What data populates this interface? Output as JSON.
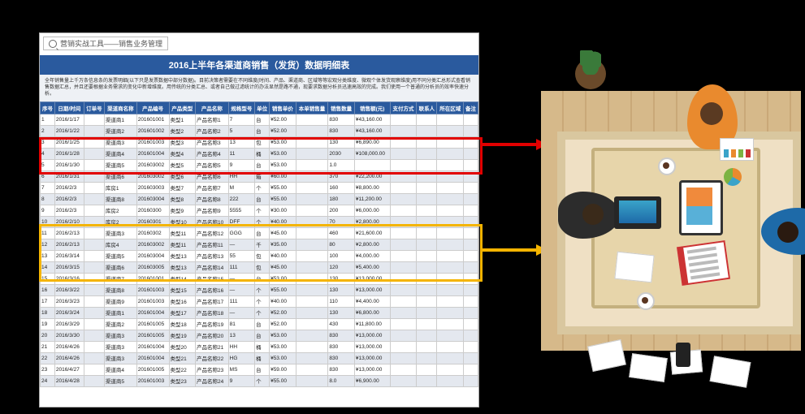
{
  "search": {
    "label": "营销实战工具——销售业务管理"
  },
  "title": "2016上半年各渠道商销售（发货）数据明细表",
  "description": "全年销售量上千万条信息条的发票明细(以下只是发票数据中部分数据)。目前决策者需要在不同维度(时间、产品、渠道商、区域等等宏观分类维度、微观个体发货观察维度)用不同分类汇总形式查看销售数据汇总，并且还要根据业务需求的变化中新增维度。用传统的分类汇总、或者自己做过滤统计的办法显然是路不通，现要求数据分析员迅速高效的完成。我们使用一个普通的分析员的效率快速分析。",
  "columns": [
    "序号",
    "日期/时间",
    "订单号",
    "渠道商名称",
    "产品编号",
    "产品类型",
    "产品名称",
    "规格型号",
    "单位",
    "销售单价",
    "本单销售量",
    "销售数量",
    "销售额(元)",
    "支付方式",
    "联系人",
    "所在区域",
    "备注"
  ],
  "rows": [
    {
      "c": [
        "1",
        "2016/1/17",
        "",
        "渠道商1",
        "201601001",
        "类型1",
        "产品名称1",
        "7",
        "台",
        "¥52.00",
        "",
        "830",
        "¥43,160.00",
        "",
        "",
        "",
        ""
      ]
    },
    {
      "c": [
        "2",
        "2016/1/22",
        "",
        "渠道商2",
        "201601002",
        "类型2",
        "产品名称2",
        "5",
        "台",
        "¥52.00",
        "",
        "830",
        "¥43,160.00",
        "",
        "",
        "",
        ""
      ]
    },
    {
      "c": [
        "3",
        "2016/1/25",
        "",
        "渠道商3",
        "201601003",
        "类型3",
        "产品名称3",
        "13",
        "包",
        "¥53.00",
        "",
        "130",
        "¥6,890.00",
        "",
        "",
        "",
        ""
      ]
    },
    {
      "c": [
        "4",
        "2016/1/28",
        "",
        "渠道商4",
        "201601004",
        "类型4",
        "产品名称4",
        "11",
        "桶",
        "¥53.00",
        "",
        "2030",
        "¥108,000.00",
        "",
        "",
        "",
        ""
      ]
    },
    {
      "c": [
        "5",
        "2016/1/30",
        "",
        "渠道商5",
        "201603002",
        "类型5",
        "产品名称5",
        "9",
        "台",
        "¥53.00",
        "",
        "1.0",
        "",
        "",
        "",
        "",
        ""
      ]
    },
    {
      "c": [
        "6",
        "2016/1/31",
        "",
        "渠道商6",
        "201603002",
        "类型6",
        "产品名称6",
        "HH",
        "箱",
        "¥60.00",
        "",
        "370",
        "¥22,200.00",
        "",
        "",
        "",
        ""
      ]
    },
    {
      "c": [
        "7",
        "2016/2/3",
        "",
        "库房1",
        "201603003",
        "类型7",
        "产品名称7",
        "M",
        "个",
        "¥55.00",
        "",
        "160",
        "¥8,800.00",
        "",
        "",
        "",
        ""
      ]
    },
    {
      "c": [
        "8",
        "2016/2/3",
        "",
        "渠道商8",
        "201603004",
        "类型8",
        "产品名称8",
        "222",
        "台",
        "¥55.00",
        "",
        "180",
        "¥11,200.00",
        "",
        "",
        "",
        ""
      ]
    },
    {
      "c": [
        "9",
        "2016/2/3",
        "",
        "库房2",
        "20160300",
        "类型9",
        "产品名称9",
        "5555",
        "个",
        "¥30.00",
        "",
        "200",
        "¥6,000.00",
        "",
        "",
        "",
        ""
      ]
    },
    {
      "c": [
        "10",
        "2016/2/10",
        "",
        "库房2",
        "20160301",
        "类型10",
        "产品名称10",
        "DFF",
        "个",
        "¥40.00",
        "",
        "70",
        "¥2,800.00",
        "",
        "",
        "",
        ""
      ]
    },
    {
      "c": [
        "11",
        "2016/2/13",
        "",
        "渠道商3",
        "20160302",
        "类型11",
        "产品名称12",
        "GGG",
        "台",
        "¥45.00",
        "",
        "460",
        "¥21,600.00",
        "",
        "",
        "",
        ""
      ]
    },
    {
      "c": [
        "12",
        "2016/2/13",
        "",
        "库房4",
        "201603002",
        "类型11",
        "产品名称11",
        "—",
        "千",
        "¥35.00",
        "",
        "80",
        "¥2,800.00",
        "",
        "",
        "",
        ""
      ]
    },
    {
      "c": [
        "13",
        "2016/3/14",
        "",
        "渠道商5",
        "201603004",
        "类型13",
        "产品名称13",
        "55",
        "包",
        "¥40.00",
        "",
        "100",
        "¥4,000.00",
        "",
        "",
        "",
        ""
      ]
    },
    {
      "c": [
        "14",
        "2016/3/15",
        "",
        "渠道商6",
        "201603005",
        "类型13",
        "产品名称14",
        "111",
        "包",
        "¥45.00",
        "",
        "120",
        "¥5,400.00",
        "",
        "",
        "",
        ""
      ]
    },
    {
      "c": [
        "15",
        "2016/3/16",
        "",
        "渠道商7",
        "201601001",
        "类型14",
        "产品名称15",
        "—",
        "台",
        "¥53.00",
        "",
        "130",
        "¥13,000.00",
        "",
        "",
        "",
        ""
      ]
    },
    {
      "c": [
        "16",
        "2016/3/22",
        "",
        "渠道商8",
        "201601003",
        "类型15",
        "产品名称16",
        "—",
        "个",
        "¥55.00",
        "",
        "130",
        "¥13,000.00",
        "",
        "",
        "",
        ""
      ]
    },
    {
      "c": [
        "17",
        "2016/3/23",
        "",
        "渠道商9",
        "201601003",
        "类型16",
        "产品名称17",
        "111",
        "个",
        "¥40.00",
        "",
        "110",
        "¥4,400.00",
        "",
        "",
        "",
        ""
      ]
    },
    {
      "c": [
        "18",
        "2016/3/24",
        "",
        "渠道商1",
        "201601004",
        "类型17",
        "产品名称18",
        "—",
        "个",
        "¥52.00",
        "",
        "130",
        "¥6,800.00",
        "",
        "",
        "",
        ""
      ]
    },
    {
      "c": [
        "19",
        "2016/3/29",
        "",
        "渠道商2",
        "201601005",
        "类型18",
        "产品名称19",
        "81",
        "台",
        "¥52.00",
        "",
        "430",
        "¥11,800.00",
        "",
        "",
        "",
        ""
      ]
    },
    {
      "c": [
        "20",
        "2016/3/30",
        "",
        "渠道商3",
        "201601005",
        "类型19",
        "产品名称20",
        "13",
        "台",
        "¥53.00",
        "",
        "830",
        "¥13,000.00",
        "",
        "",
        "",
        ""
      ]
    },
    {
      "c": [
        "21",
        "2016/4/26",
        "",
        "渠道商3",
        "201601004",
        "类型20",
        "产品名称21",
        "HH",
        "桶",
        "¥53.00",
        "",
        "830",
        "¥13,000.00",
        "",
        "",
        "",
        ""
      ]
    },
    {
      "c": [
        "22",
        "2016/4/26",
        "",
        "渠道商3",
        "201601004",
        "类型21",
        "产品名称22",
        "HG",
        "桶",
        "¥53.00",
        "",
        "830",
        "¥13,000.00",
        "",
        "",
        "",
        ""
      ]
    },
    {
      "c": [
        "23",
        "2016/4/27",
        "",
        "渠道商4",
        "201601005",
        "类型22",
        "产品名称23",
        "MS",
        "台",
        "¥59.00",
        "",
        "830",
        "¥13,000.00",
        "",
        "",
        "",
        ""
      ]
    },
    {
      "c": [
        "24",
        "2016/4/28",
        "",
        "渠道商5",
        "201601003",
        "类型23",
        "产品名称24",
        "9",
        "个",
        "¥55.00",
        "",
        "8.0",
        "¥6,900.00",
        "",
        "",
        "",
        ""
      ]
    }
  ],
  "highlights": {
    "red_rows": "rows 2–4",
    "yellow_rows": "rows 10–14"
  }
}
